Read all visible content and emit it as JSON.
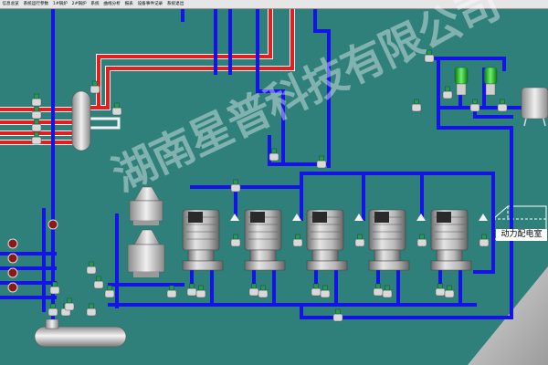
{
  "menubar": {
    "items": [
      "信息总览",
      "系统运行参数",
      "1#锅炉",
      "2#锅炉",
      "系统",
      "曲线分析",
      "报表",
      "设备事件记录",
      "系统退出"
    ]
  },
  "scene": {
    "power_room_label": "动力配电室",
    "pump_count": 5,
    "watermark": "湖南星普科技有限公司"
  },
  "colors": {
    "background": "#2f7f7a",
    "water_pipe": "#1414e6",
    "steam_pipe": "#e02020",
    "white_pipe": "#f2f2f2",
    "menubar": "#e6e6e6"
  },
  "icons": [
    "pump-icon",
    "valve-icon",
    "tank-icon",
    "filter-tank-icon",
    "check-valve-icon",
    "gauge-icon"
  ]
}
